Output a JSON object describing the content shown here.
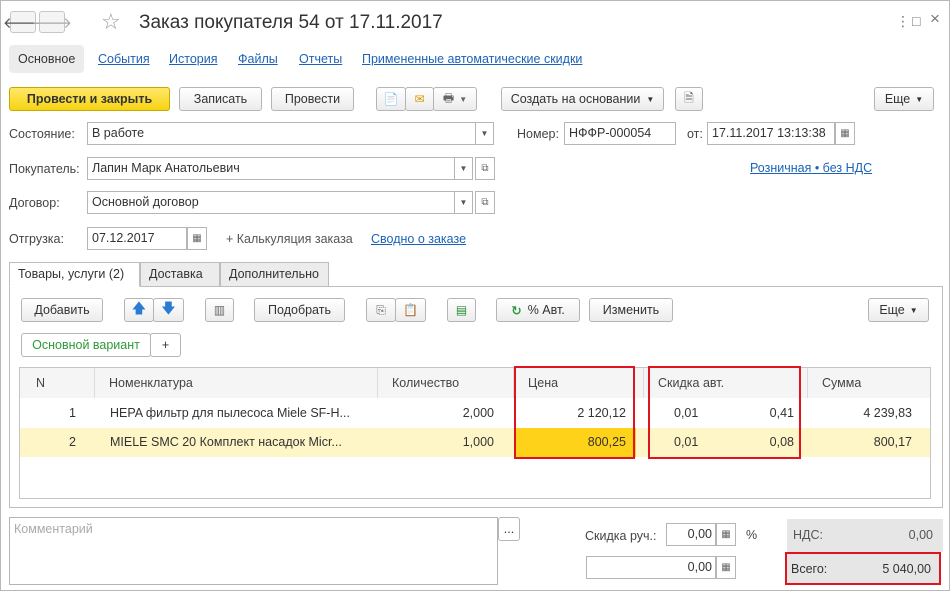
{
  "window": {
    "title": "Заказ покупателя 54 от 17.11.2017",
    "back_icon": "arrow-left-icon",
    "forward_icon": "arrow-right-icon",
    "favorite_icon": "star-icon",
    "menu_icon": "⋮",
    "maximize_icon": "□",
    "close_icon": "×"
  },
  "sections": [
    {
      "label": "Основное",
      "active": true
    },
    {
      "label": "События"
    },
    {
      "label": "История"
    },
    {
      "label": "Файлы"
    },
    {
      "label": "Отчеты"
    },
    {
      "label": "Примененные автоматические скидки"
    }
  ],
  "toolbar": {
    "post_close": "Провести и закрыть",
    "write": "Записать",
    "post": "Провести",
    "create_based": "Создать на основании",
    "more": "Еще"
  },
  "form": {
    "state_label": "Состояние:",
    "state_value": "В работе",
    "number_label": "Номер:",
    "number_value": "НФФР-000054",
    "date_label": "от:",
    "date_value": "17.11.2017 13:13:38",
    "buyer_label": "Покупатель:",
    "buyer_value": "Лапин Марк Анатольевич",
    "price_type_link": "Розничная • без НДС",
    "contract_label": "Договор:",
    "contract_value": "Основной договор",
    "shipment_label": "Отгрузка:",
    "shipment_value": "07.12.2017",
    "calc_text": "+ Калькуляция заказа",
    "summary_link": "Сводно о заказе"
  },
  "tabs": [
    {
      "label": "Товары, услуги (2)",
      "active": true
    },
    {
      "label": "Доставка"
    },
    {
      "label": "Дополнительно"
    }
  ],
  "table_toolbar": {
    "add": "Добавить",
    "pick": "Подобрать",
    "auto_discount": "% Авт.",
    "edit": "Изменить",
    "more": "Еще",
    "variant": "Основной вариант",
    "plus": "+"
  },
  "table": {
    "columns": [
      "N",
      "Номенклатура",
      "Количество",
      "Цена",
      "Скидка авт.",
      "Сумма"
    ],
    "rows": [
      {
        "n": "1",
        "item": "HEPA фильтр для пылесоса Miele SF-H...",
        "qty": "2,000",
        "price": "2 120,12",
        "disc_pct": "0,01",
        "disc_sum": "0,41",
        "sum": "4 239,83"
      },
      {
        "n": "2",
        "item": "MIELE SMC 20 Комплект насадок Micr...",
        "qty": "1,000",
        "price": "800,25",
        "disc_pct": "0,01",
        "disc_sum": "0,08",
        "sum": "800,17"
      }
    ]
  },
  "footer": {
    "comment_placeholder": "Комментарий",
    "comment_btn": "...",
    "manual_discount_label": "Скидка руч.:",
    "manual_discount_value": "0,00",
    "percent": "%",
    "manual_discount_sum": "0,00",
    "vat_label": "НДС:",
    "vat_value": "0,00",
    "total_label": "Всего:",
    "total_value": "5 040,00"
  },
  "colors": {
    "primary_button": "#f6d413",
    "link": "#1c63b7",
    "selected_row": "#fff6c8",
    "selected_cell": "#ffd21a",
    "highlight_box": "#e0141e"
  }
}
